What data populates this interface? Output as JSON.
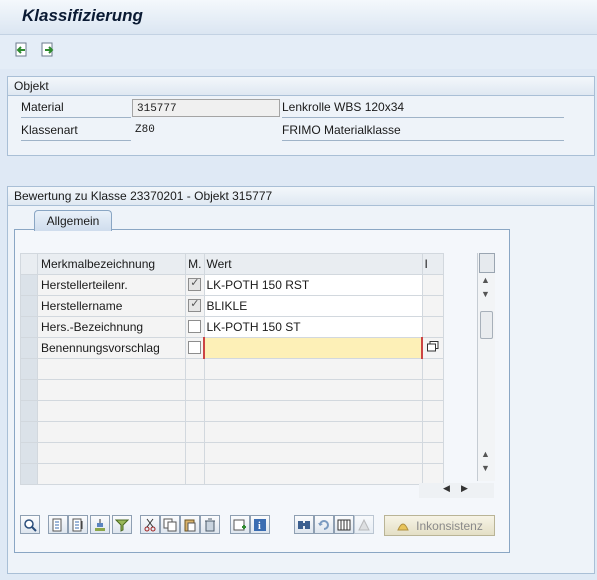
{
  "header": {
    "title": "Klassifizierung"
  },
  "toolbar": {
    "icons": [
      "previous-object-icon",
      "next-object-icon"
    ]
  },
  "objekt": {
    "title": "Objekt",
    "material_label": "Material",
    "material_value": "315777",
    "material_desc": "Lenkrolle WBS 120x34",
    "klassenart_label": "Klassenart",
    "klassenart_value": "Z80",
    "klassenart_desc": "FRIMO Materialklasse"
  },
  "bewertung": {
    "title": "Bewertung zu Klasse 23370201 - Objekt 315777",
    "tab_label": "Allgemein",
    "columns": {
      "merkmal": "Merkmalbezeichnung",
      "m": "M.",
      "wert": "Wert",
      "i": "I"
    },
    "rows": [
      {
        "merkmal": "Herstellerteilenr.",
        "checked": true,
        "wert": "LK-POTH 150 RST"
      },
      {
        "merkmal": "Herstellername",
        "checked": true,
        "wert": "BLIKLE"
      },
      {
        "merkmal": "Hers.-Bezeichnung",
        "checked": false,
        "wert": "LK-POTH 150 ST"
      },
      {
        "merkmal": "Benennungsvorschlag",
        "checked": false,
        "wert": ""
      }
    ],
    "inkonsistenz_label": "Inkonsistenz"
  }
}
